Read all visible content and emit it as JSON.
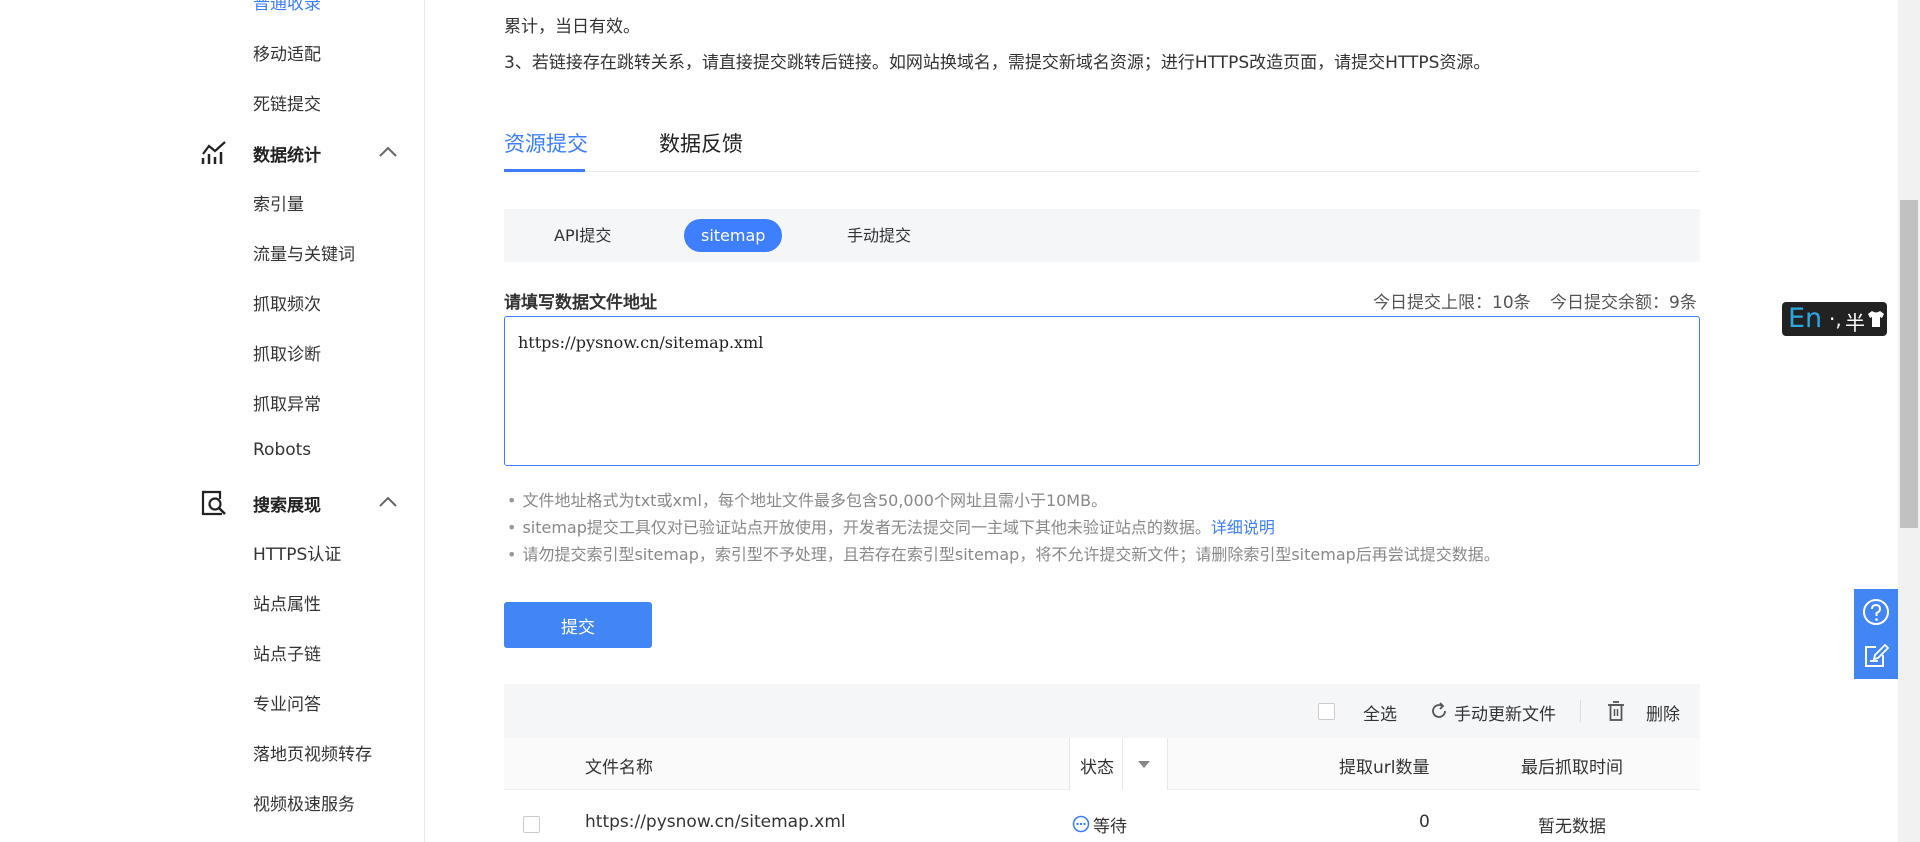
{
  "sidebar": {
    "partial_item": "普通收录",
    "items_top": [
      "移动适配",
      "死链提交"
    ],
    "groups": [
      {
        "label": "数据统计",
        "icon": "chart-icon",
        "items": [
          "索引量",
          "流量与关键词",
          "抓取频次",
          "抓取诊断",
          "抓取异常",
          "Robots"
        ]
      },
      {
        "label": "搜索展现",
        "icon": "search-display-icon",
        "items": [
          "HTTPS认证",
          "站点属性",
          "站点子链",
          "专业问答",
          "落地页视频转存",
          "视频极速服务"
        ]
      }
    ]
  },
  "notice": {
    "line1": "累计，当日有效。",
    "line2": "3、若链接存在跳转关系，请直接提交跳转后链接。如网站换域名，需提交新域名资源；进行HTTPS改造页面，请提交HTTPS资源。"
  },
  "tabs": [
    {
      "label": "资源提交",
      "active": true
    },
    {
      "label": "数据反馈",
      "active": false
    }
  ],
  "subtabs": [
    {
      "label": "API提交",
      "active": false
    },
    {
      "label": "sitemap",
      "active": true
    },
    {
      "label": "手动提交",
      "active": false
    }
  ],
  "form": {
    "label": "请填写数据文件地址",
    "quota_limit": "今日提交上限：10条",
    "quota_remaining": "今日提交余额：9条",
    "input_value": "https://pysnow.cn/sitemap.xml"
  },
  "tips": [
    "文件地址格式为txt或xml，每个地址文件最多包含50,000个网址且需小于10MB。",
    "sitemap提交工具仅对已验证站点开放使用，开发者无法提交同一主域下其他未验证站点的数据。",
    "请勿提交索引型sitemap，索引型不予处理，且若存在索引型sitemap，将不允许提交新文件；请删除索引型sitemap后再尝试提交数据。"
  ],
  "tip_link": "详细说明",
  "submit_label": "提交",
  "table": {
    "toolbar": {
      "select_all": "全选",
      "refresh": "手动更新文件",
      "delete": "删除"
    },
    "headers": {
      "file_name": "文件名称",
      "status": "状态",
      "url_count": "提取url数量",
      "last_crawl": "最后抓取时间"
    },
    "rows": [
      {
        "file_name": "https://pysnow.cn/sitemap.xml",
        "status": "等待",
        "url_count": "0",
        "last_crawl": "暂无数据"
      }
    ]
  },
  "ime": {
    "lang": "En",
    "punct": "·,",
    "width": "半",
    "icon": "shirt-icon"
  },
  "colors": {
    "accent": "#3d7fff",
    "button": "#4285f4",
    "panel_bg": "#f5f6f8"
  }
}
